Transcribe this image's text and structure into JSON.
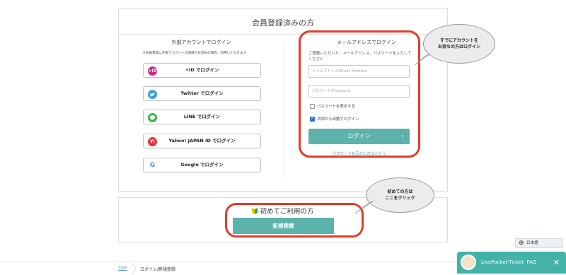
{
  "registered_section": {
    "title": "会員登録済みの方",
    "external": {
      "title": "外部アカウントでログイン",
      "note": "※会員登録に外部アカウントの連携がお済みの場合、利用いただけます",
      "buttons": [
        {
          "label": "+ID でログイン",
          "icon": "plus-id-icon",
          "glyph": "+ID",
          "color": "#d5297b"
        },
        {
          "label": "Twitter でログイン",
          "icon": "twitter-icon",
          "glyph": "t",
          "color": "#3d9fdb"
        },
        {
          "label": "LINE でログイン",
          "icon": "line-icon",
          "glyph": "L",
          "color": "#3ab54a"
        },
        {
          "label": "Yahoo! JAPAN ID でログイン",
          "icon": "yahoo-icon",
          "glyph": "Y!",
          "color": "#e0373a"
        },
        {
          "label": "Google でログイン",
          "icon": "google-icon",
          "glyph": "G",
          "color": "#4285f4"
        }
      ]
    },
    "mail": {
      "title": "メールアドレスでログイン",
      "description": "ご登録いただいた、メールアドレス、パスワードを入力してください",
      "email_placeholder": "メールアドレス/Email Address",
      "password_placeholder": "パスワード/Password",
      "show_password_label": "パスワードを表示する",
      "show_password_checked": false,
      "auto_login_label": "次回から自動でログイン",
      "auto_login_checked": true,
      "login_label": "ログイン",
      "forgot_label": "パスワードを忘れた方はこちら"
    }
  },
  "callouts": {
    "existing": [
      "すでにアカウントを",
      "お持ちの方はログイン"
    ],
    "first": [
      "初めての方は",
      "ここをクリック"
    ]
  },
  "first_time_section": {
    "title": "初めてご利用の方",
    "register_label": "新規登録"
  },
  "breadcrumb": {
    "top": "TOP",
    "current": "ログイン/新規登録"
  },
  "language": {
    "label": "日本語"
  },
  "faq_widget": {
    "label": "LivePocket-Ticket- FAQ"
  },
  "colors": {
    "accent": "#5db3ab",
    "highlight": "#e23b2c",
    "link": "#4aa9a1"
  }
}
